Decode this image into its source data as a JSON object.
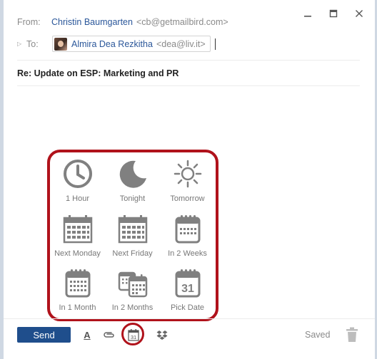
{
  "header": {
    "from_label": "From:",
    "from_name": "Christin Baumgarten",
    "from_email": "<cb@getmailbird.com>",
    "to_label": "To:",
    "to_name": "Almira Dea Rezkitha",
    "to_email": "<dea@liv.it>"
  },
  "window_controls": [
    "minimize-icon",
    "maximize-icon",
    "close-icon"
  ],
  "subject": "Re: Update on ESP: Marketing and PR",
  "snooze": {
    "options": [
      {
        "label": "1 Hour",
        "icon": "clock-icon"
      },
      {
        "label": "Tonight",
        "icon": "moon-icon"
      },
      {
        "label": "Tomorrow",
        "icon": "sun-icon"
      },
      {
        "label": "Next Monday",
        "icon": "calendar-week-icon"
      },
      {
        "label": "Next Friday",
        "icon": "calendar-week-icon"
      },
      {
        "label": "In 2 Weeks",
        "icon": "calendar-icon"
      },
      {
        "label": "In 1 Month",
        "icon": "calendar-month-icon"
      },
      {
        "label": "In 2 Months",
        "icon": "calendar-stack-icon"
      },
      {
        "label": "Pick Date",
        "icon": "calendar-31-icon"
      }
    ],
    "pick_date_day": "31",
    "highlight_color": "#b0121b"
  },
  "toolbar": {
    "send_label": "Send",
    "font_label": "A",
    "snooze_day": "31",
    "saved_label": "Saved"
  },
  "colors": {
    "accent": "#1f4e8c",
    "link": "#2b579a",
    "icon_gray": "#808080"
  }
}
